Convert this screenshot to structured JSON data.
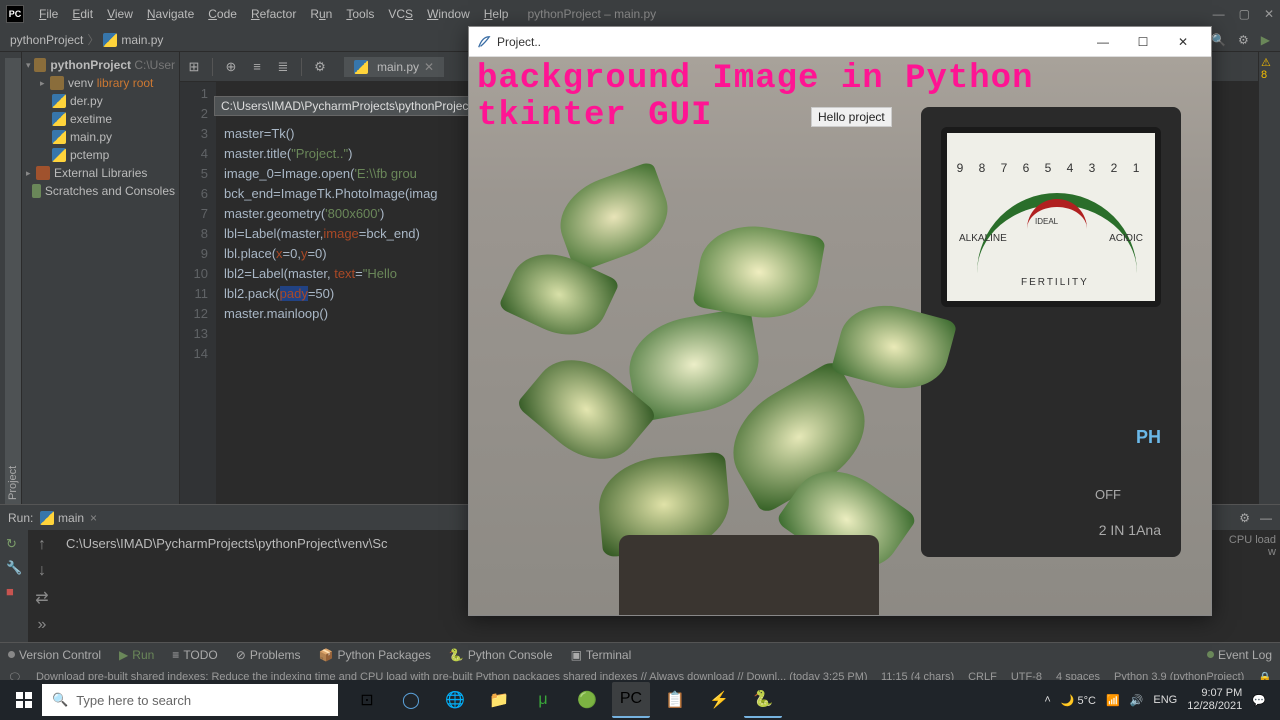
{
  "ide": {
    "menu": [
      "File",
      "Edit",
      "View",
      "Navigate",
      "Code",
      "Refactor",
      "Run",
      "Tools",
      "VCS",
      "Window",
      "Help"
    ],
    "title": "pythonProject – main.py",
    "breadcrumb": {
      "project": "pythonProject",
      "file": "main.py"
    },
    "tooltip": "C:\\Users\\IMAD\\PycharmProjects\\pythonProject\\ma",
    "project_tree": {
      "root": "pythonProject",
      "root_hint": "C:\\User",
      "venv": "venv",
      "venv_hint": "library root",
      "files": [
        "der.py",
        "exetime",
        "main.py",
        "pctemp"
      ],
      "ext": "External Libraries",
      "scratch": "Scratches and Consoles"
    },
    "tab": "main.py",
    "line_nums": [
      "1",
      "2",
      "3",
      "4",
      "5",
      "6",
      "7",
      "8",
      "9",
      "10",
      "11",
      "12",
      "13",
      "14"
    ],
    "code": {
      "l3": "master=Tk()",
      "l4a": "master.title(",
      "l4b": "\"Project..\"",
      "l4c": ")",
      "l5a": "image_0=Image.open(",
      "l5b": "'E:\\\\fb grou",
      "l6": "bck_end=ImageTk.PhotoImage(imag",
      "l7a": "master.geometry(",
      "l7b": "'800x600'",
      "l7c": ")",
      "l8a": "lbl=Label(master,",
      "l8b": "image",
      "l8c": "=bck_end)",
      "l9a": "lbl.place(",
      "l9b": "x",
      "l9c": "=0,",
      "l9d": "y",
      "l9e": "=0)",
      "l10a": "lbl2=Label(master, ",
      "l10b": "text",
      "l10c": "=",
      "l10d": "\"Hello",
      "l11a": "lbl2.pack(",
      "l11b": "pady",
      "l11c": "=50)",
      "l12": "master.mainloop()"
    },
    "inspection": "⚠ 8",
    "run_label": "Run:",
    "run_name": "main",
    "console_line": "C:\\Users\\IMAD\\PycharmProjects\\pythonProject\\venv\\Sc",
    "bottom_tabs": {
      "version": "Version Control",
      "run": "Run",
      "todo": "TODO",
      "problems": "Problems",
      "packages": "Python Packages",
      "pyconsole": "Python Console",
      "terminal": "Terminal",
      "eventlog": "Event Log"
    },
    "status": {
      "msg": "Download pre-built shared indexes: Reduce the indexing time and CPU load with pre-built Python packages shared indexes // Always download // Downl... (today 3:25 PM)",
      "sel": "11:15 (4 chars)",
      "crlf": "CRLF",
      "enc": "UTF-8",
      "indent": "4 spaces",
      "py": "Python 3.9 (pythonProject)",
      "cpu": "CPU load w"
    }
  },
  "tk": {
    "title": "Project..",
    "heading": "background Image in Python tkinter GUI",
    "lbl2": "Hello project",
    "gauge_nums": "9 8 7 6 5 4 3 2 1",
    "alkaline": "ALKALINE",
    "acidic": "ACIDIC",
    "ideal": "IDEAL",
    "fert": "FERTILITY",
    "ph": "PH",
    "off": "OFF",
    "twoin1": "2 IN 1Ana"
  },
  "taskbar": {
    "search_placeholder": "Type here to search",
    "weather": "5°C",
    "time": "9:07 PM",
    "date": "12/28/2021"
  }
}
